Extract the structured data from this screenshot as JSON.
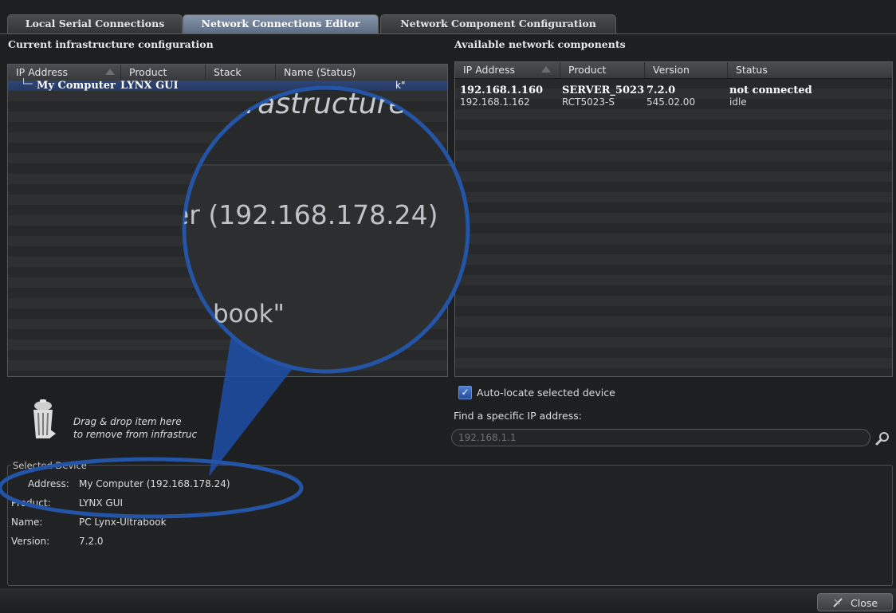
{
  "tabs": [
    {
      "label": "Local Serial Connections"
    },
    {
      "label": "Network Connections Editor"
    },
    {
      "label": "Network Component Configuration"
    }
  ],
  "left_panel": {
    "title": "Current infrastructure configuration",
    "columns": [
      "IP Address",
      "Product",
      "Stack",
      "Name (Status)"
    ],
    "row": {
      "ip": "My Computer",
      "product": "LYNX GUI",
      "name_fragment": "k\""
    }
  },
  "right_panel": {
    "title": "Available network components",
    "columns": [
      "IP Address",
      "Product",
      "Version",
      "Status"
    ],
    "rows": [
      {
        "ip": "192.168.1.160",
        "product": "SERVER_5023",
        "version": "7.2.0",
        "status": "not connected"
      },
      {
        "ip": "192.168.1.162",
        "product": "RCT5023-S",
        "version": "545.02.00",
        "status": "idle"
      }
    ]
  },
  "auto_locate": {
    "label": "Auto-locate selected device",
    "checked": true
  },
  "find_ip": {
    "label": "Find a specific IP address:",
    "value": "192.168.1.1"
  },
  "trash": {
    "line1": "Drag & drop item here",
    "line2": "to remove from infrastruc"
  },
  "selected_device": {
    "title": "Selected Device",
    "address_label": "Address:",
    "address_value": "My Computer (192.168.178.24)",
    "product_label": "Product:",
    "product_value": "LYNX GUI",
    "name_label": "Name:",
    "name_value": "PC Lynx-Ultrabook",
    "version_label": "Version:",
    "version_value": "7.2.0"
  },
  "close_button": {
    "label": "Close"
  },
  "magnifier": {
    "line1": "nfrastructure",
    "line2": "er (192.168.178.24)",
    "line3": "book\""
  },
  "colors": {
    "accent": "#2d4a7a",
    "highlight": "#1f4fa8",
    "tab_active": "#6d7c92"
  }
}
